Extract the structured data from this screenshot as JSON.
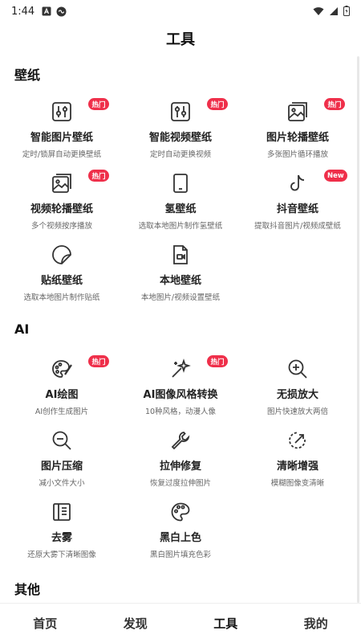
{
  "status": {
    "time": "1:44"
  },
  "header": {
    "title": "工具"
  },
  "sections": {
    "wallpaper": {
      "title": "壁纸",
      "items": [
        {
          "name": "智能图片壁纸",
          "desc": "定时/锁屏自动更换壁纸",
          "badge": "热门",
          "icon": "adjust-sliders-icon"
        },
        {
          "name": "智能视频壁纸",
          "desc": "定时自动更换视频",
          "badge": "热门",
          "icon": "adjust-sliders-icon"
        },
        {
          "name": "图片轮播壁纸",
          "desc": "多张图片循环播放",
          "badge": "热门",
          "icon": "image-stack-icon"
        },
        {
          "name": "视频轮播壁纸",
          "desc": "多个视频按序播放",
          "badge": "热门",
          "icon": "image-stack-icon"
        },
        {
          "name": "氢壁纸",
          "desc": "选取本地图片制作氢壁纸",
          "badge": "",
          "icon": "phone-icon"
        },
        {
          "name": "抖音壁纸",
          "desc": "提取抖音图片/视频成壁纸",
          "badge": "New",
          "icon": "tiktok-icon"
        },
        {
          "name": "贴纸壁纸",
          "desc": "选取本地图片制作贴纸",
          "badge": "",
          "icon": "sticker-icon"
        },
        {
          "name": "本地壁纸",
          "desc": "本地图片/视频设置壁纸",
          "badge": "",
          "icon": "video-file-icon"
        }
      ]
    },
    "ai": {
      "title": "AI",
      "items": [
        {
          "name": "AI绘图",
          "desc": "AI创作生成图片",
          "badge": "热门",
          "icon": "palette-icon"
        },
        {
          "name": "AI图像风格转换",
          "desc": "10种风格，动漫人像",
          "badge": "热门",
          "icon": "magic-wand-icon"
        },
        {
          "name": "无损放大",
          "desc": "图片快速放大两倍",
          "badge": "",
          "icon": "zoom-in-icon"
        },
        {
          "name": "图片压缩",
          "desc": "减小文件大小",
          "badge": "",
          "icon": "zoom-out-icon"
        },
        {
          "name": "拉伸修复",
          "desc": "恢复过度拉伸图片",
          "badge": "",
          "icon": "wrench-icon"
        },
        {
          "name": "清晰增强",
          "desc": "模糊图像变清晰",
          "badge": "",
          "icon": "enhance-icon"
        },
        {
          "name": "去雾",
          "desc": "还原大雾下清晰图像",
          "badge": "",
          "icon": "book-icon"
        },
        {
          "name": "黑白上色",
          "desc": "黑白图片填充色彩",
          "badge": "",
          "icon": "palette-icon"
        }
      ]
    },
    "other": {
      "title": "其他"
    }
  },
  "nav": {
    "home": "首页",
    "discover": "发现",
    "tools": "工具",
    "mine": "我的",
    "active": "tools"
  }
}
